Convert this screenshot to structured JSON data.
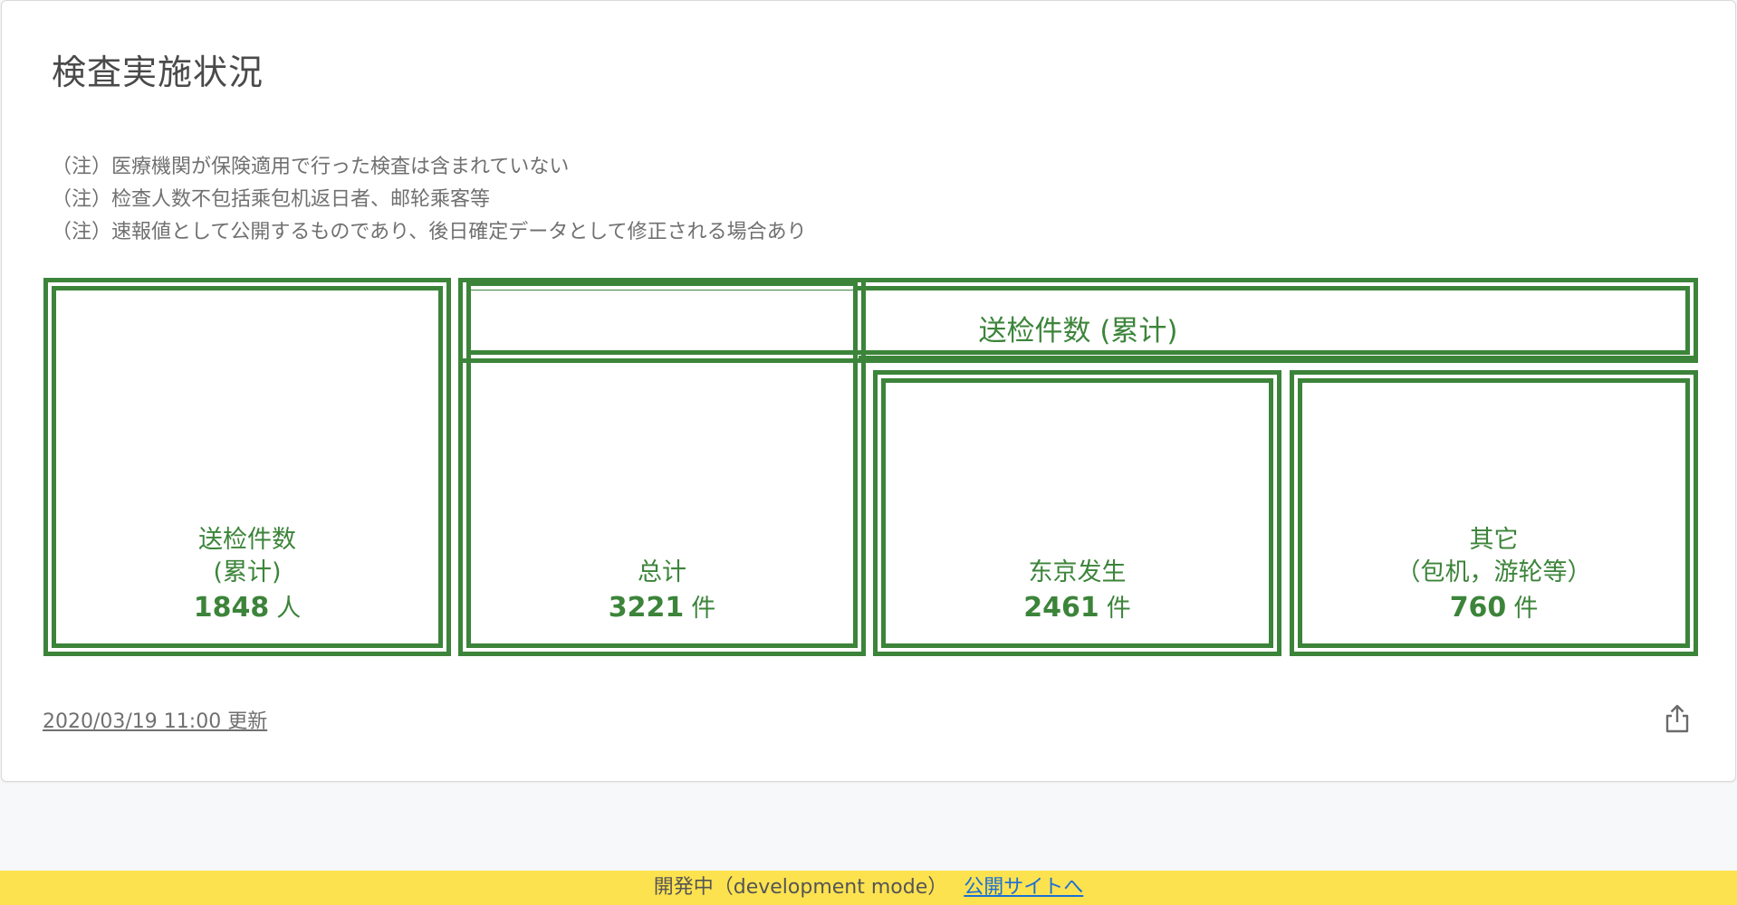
{
  "card": {
    "title": "検査実施状況",
    "notes": [
      "（注）医療機関が保険適用で行った検査は含まれていない",
      "（注）检查人数不包括乘包机返日者、邮轮乘客等",
      "（注）速報値として公開するものであり、後日確定データとして修正される場合あり"
    ],
    "boxes": {
      "people": {
        "label1": "送检件数",
        "label2": "(累计)",
        "value": "1848",
        "unit": "人"
      },
      "header": {
        "label": "送检件数 (累计)"
      },
      "total": {
        "label": "总计",
        "value": "3221",
        "unit": "件"
      },
      "tokyo": {
        "label": "东京发生",
        "value": "2461",
        "unit": "件"
      },
      "other": {
        "label1": "其它",
        "label2": "（包机，游轮等）",
        "value": "760",
        "unit": "件"
      }
    },
    "updated": "2020/03/19 11:00 更新",
    "share_icon": "share-icon"
  },
  "devbar": {
    "text": "開発中（development mode）",
    "link": "公開サイトへ"
  },
  "colors": {
    "accent_green": "#3c843a",
    "devbar_yellow": "#fde24f",
    "link_blue": "#1a6fd6"
  }
}
